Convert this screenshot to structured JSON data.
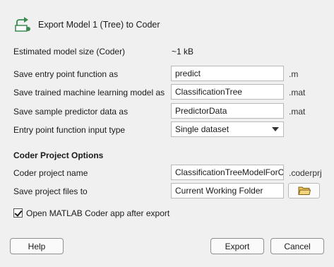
{
  "header": {
    "title": "Export Model 1 (Tree) to Coder",
    "icon": "export-to-coder-icon"
  },
  "model_size": {
    "label": "Estimated model size (Coder)",
    "value": "~1 kB"
  },
  "entry_point": {
    "label": "Save entry point function as",
    "value": "predict",
    "suffix": ".m"
  },
  "trained_model": {
    "label": "Save trained machine learning model as",
    "value": "ClassificationTree",
    "suffix": ".mat"
  },
  "sample_data": {
    "label": "Save sample predictor data as",
    "value": "PredictorData",
    "suffix": ".mat"
  },
  "input_type": {
    "label": "Entry point function input type",
    "selected": "Single dataset"
  },
  "coder_project": {
    "section_title": "Coder Project Options",
    "name_label": "Coder project name",
    "name_value": "ClassificationTreeModelForCo",
    "name_suffix": ".coderprj",
    "files_label": "Save project files to",
    "files_value": "Current Working Folder"
  },
  "open_coder": {
    "label": "Open MATLAB Coder app after export",
    "checked": true
  },
  "buttons": {
    "help": "Help",
    "export": "Export",
    "cancel": "Cancel"
  },
  "colors": {
    "folder": "#e8c25a",
    "icon_green": "#3a8a4f"
  }
}
